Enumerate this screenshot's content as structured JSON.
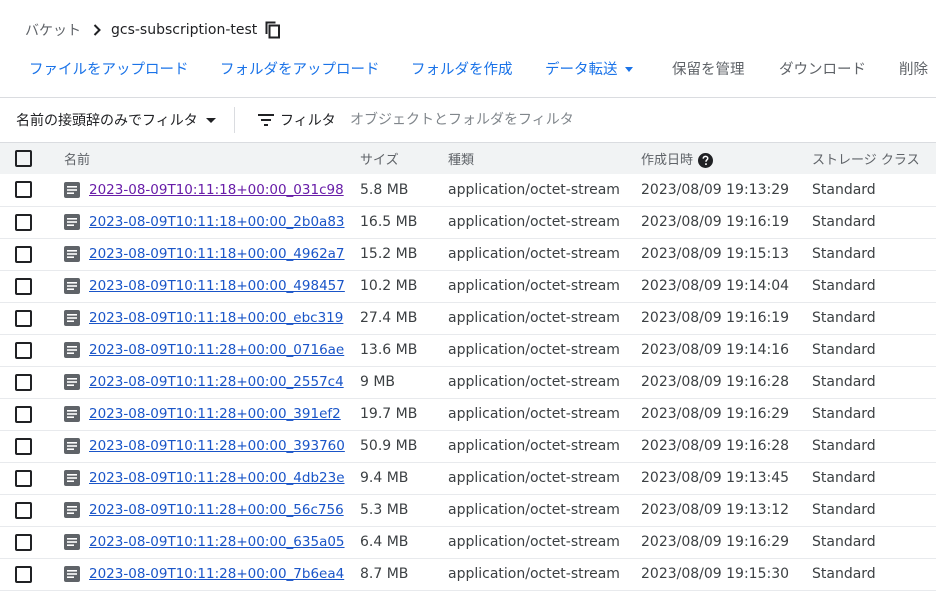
{
  "breadcrumb": {
    "root": "バケット",
    "bucket": "gcs-subscription-test"
  },
  "actions": {
    "upload_files": "ファイルをアップロード",
    "upload_folder": "フォルダをアップロード",
    "create_folder": "フォルダを作成",
    "transfer_data": "データ転送",
    "manage_holds": "保留を管理",
    "download": "ダウンロード",
    "delete": "削除"
  },
  "filterbar": {
    "prefix_filter": "名前の接頭辞のみでフィルタ",
    "filter_label": "フィルタ",
    "search_placeholder": "オブジェクトとフォルダをフィルタ"
  },
  "colors": {
    "link": "#1a73e8",
    "visited_link": "#681da8"
  },
  "table": {
    "columns": {
      "name": "名前",
      "size": "サイズ",
      "type": "種類",
      "created": "作成日時",
      "storage_class": "ストレージ クラス"
    },
    "rows": [
      {
        "name": "2023-08-09T10:11:18+00:00_031c98",
        "size": "5.8 MB",
        "type": "application/octet-stream",
        "created": "2023/08/09 19:13:29",
        "storage_class": "Standard",
        "visited": true
      },
      {
        "name": "2023-08-09T10:11:18+00:00_2b0a83",
        "size": "16.5 MB",
        "type": "application/octet-stream",
        "created": "2023/08/09 19:16:19",
        "storage_class": "Standard"
      },
      {
        "name": "2023-08-09T10:11:18+00:00_4962a7",
        "size": "15.2 MB",
        "type": "application/octet-stream",
        "created": "2023/08/09 19:15:13",
        "storage_class": "Standard"
      },
      {
        "name": "2023-08-09T10:11:18+00:00_498457",
        "size": "10.2 MB",
        "type": "application/octet-stream",
        "created": "2023/08/09 19:14:04",
        "storage_class": "Standard"
      },
      {
        "name": "2023-08-09T10:11:18+00:00_ebc319",
        "size": "27.4 MB",
        "type": "application/octet-stream",
        "created": "2023/08/09 19:16:19",
        "storage_class": "Standard"
      },
      {
        "name": "2023-08-09T10:11:28+00:00_0716ae",
        "size": "13.6 MB",
        "type": "application/octet-stream",
        "created": "2023/08/09 19:14:16",
        "storage_class": "Standard"
      },
      {
        "name": "2023-08-09T10:11:28+00:00_2557c4",
        "size": "9 MB",
        "type": "application/octet-stream",
        "created": "2023/08/09 19:16:28",
        "storage_class": "Standard"
      },
      {
        "name": "2023-08-09T10:11:28+00:00_391ef2",
        "size": "19.7 MB",
        "type": "application/octet-stream",
        "created": "2023/08/09 19:16:29",
        "storage_class": "Standard"
      },
      {
        "name": "2023-08-09T10:11:28+00:00_393760",
        "size": "50.9 MB",
        "type": "application/octet-stream",
        "created": "2023/08/09 19:16:28",
        "storage_class": "Standard"
      },
      {
        "name": "2023-08-09T10:11:28+00:00_4db23e",
        "size": "9.4 MB",
        "type": "application/octet-stream",
        "created": "2023/08/09 19:13:45",
        "storage_class": "Standard"
      },
      {
        "name": "2023-08-09T10:11:28+00:00_56c756",
        "size": "5.3 MB",
        "type": "application/octet-stream",
        "created": "2023/08/09 19:13:12",
        "storage_class": "Standard"
      },
      {
        "name": "2023-08-09T10:11:28+00:00_635a05",
        "size": "6.4 MB",
        "type": "application/octet-stream",
        "created": "2023/08/09 19:16:29",
        "storage_class": "Standard"
      },
      {
        "name": "2023-08-09T10:11:28+00:00_7b6ea4",
        "size": "8.7 MB",
        "type": "application/octet-stream",
        "created": "2023/08/09 19:15:30",
        "storage_class": "Standard"
      }
    ]
  }
}
